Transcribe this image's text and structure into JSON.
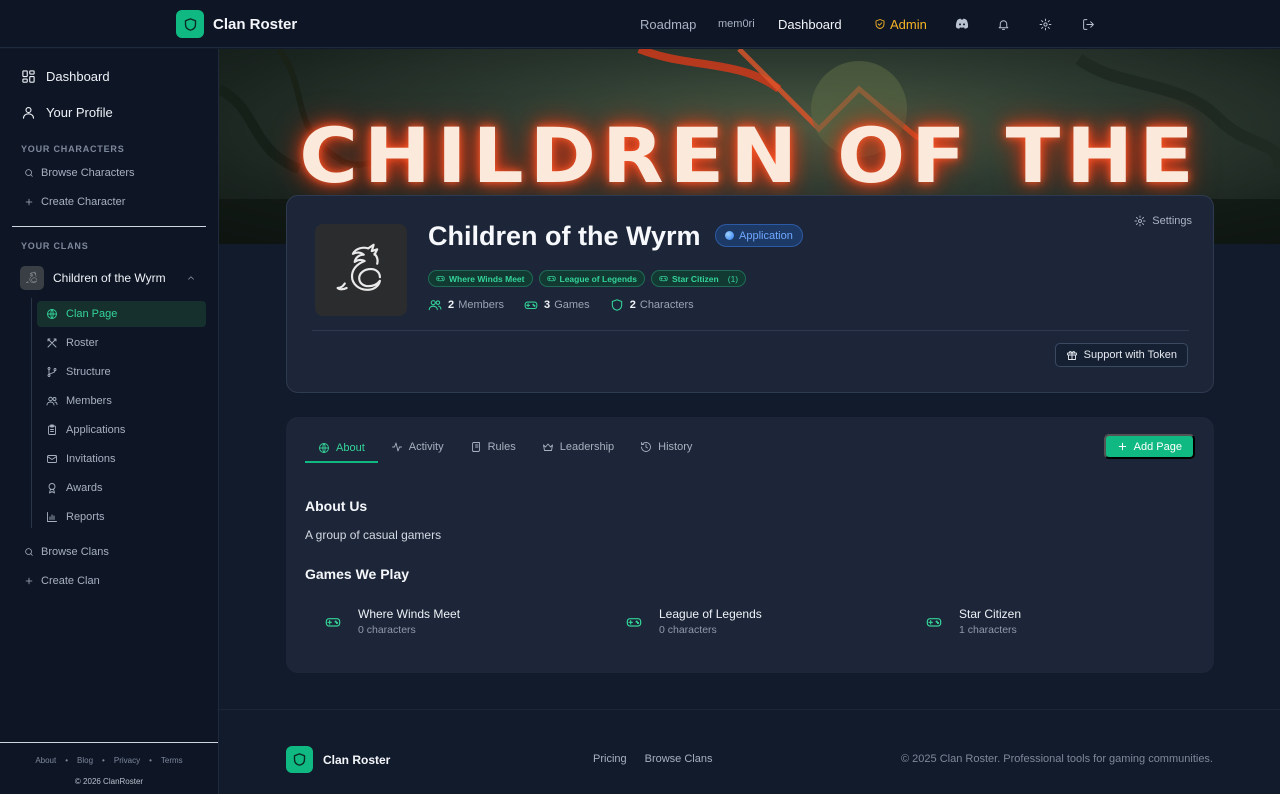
{
  "app": {
    "name": "Clan Roster"
  },
  "nav": {
    "roadmap": "Roadmap",
    "username": "mem0ri",
    "dashboard": "Dashboard",
    "admin": "Admin",
    "icons": [
      "discord-icon",
      "bell-icon",
      "gear-icon",
      "logout-icon"
    ]
  },
  "sidebar": {
    "dashboard": "Dashboard",
    "profile": "Your Profile",
    "characters_section": "YOUR CHARACTERS",
    "browse_characters": "Browse Characters",
    "create_character": "Create Character",
    "clans_section": "YOUR CLANS",
    "clan_name": "Children of the Wyrm",
    "clan_menu": [
      {
        "label": "Clan Page",
        "icon": "globe-icon",
        "active": true
      },
      {
        "label": "Roster",
        "icon": "swords-icon",
        "active": false
      },
      {
        "label": "Structure",
        "icon": "branch-icon",
        "active": false
      },
      {
        "label": "Members",
        "icon": "users-icon",
        "active": false
      },
      {
        "label": "Applications",
        "icon": "clipboard-icon",
        "active": false
      },
      {
        "label": "Invitations",
        "icon": "mail-icon",
        "active": false
      },
      {
        "label": "Awards",
        "icon": "award-icon",
        "active": false
      },
      {
        "label": "Reports",
        "icon": "chart-icon",
        "active": false
      }
    ],
    "browse_clans": "Browse Clans",
    "create_clan": "Create Clan",
    "footer_links": [
      "About",
      "Blog",
      "Privacy",
      "Terms"
    ],
    "copyright": "© 2026 ClanRoster"
  },
  "banner": {
    "text": "CHILDREN OF THE WYRM"
  },
  "clan": {
    "title": "Children of the Wyrm",
    "status": "Application",
    "settings": "Settings",
    "games": [
      {
        "name": "Where Winds Meet",
        "count": ""
      },
      {
        "name": "League of Legends",
        "count": ""
      },
      {
        "name": "Star Citizen",
        "count": "(1)"
      }
    ],
    "stats": [
      {
        "value": "2",
        "label": "Members",
        "icon": "users-icon"
      },
      {
        "value": "3",
        "label": "Games",
        "icon": "gamepad-icon"
      },
      {
        "value": "2",
        "label": "Characters",
        "icon": "shield-icon"
      }
    ],
    "support_button": "Support with Token"
  },
  "tabs": [
    {
      "label": "About",
      "icon": "globe-icon",
      "active": true
    },
    {
      "label": "Activity",
      "icon": "activity-icon",
      "active": false
    },
    {
      "label": "Rules",
      "icon": "scroll-icon",
      "active": false
    },
    {
      "label": "Leadership",
      "icon": "crown-icon",
      "active": false
    },
    {
      "label": "History",
      "icon": "history-icon",
      "active": false
    }
  ],
  "add_page": "Add Page",
  "about": {
    "heading": "About Us",
    "text": "A group of casual gamers",
    "games_heading": "Games We Play",
    "games": [
      {
        "name": "Where Winds Meet",
        "characters": "0 characters"
      },
      {
        "name": "League of Legends",
        "characters": "0 characters"
      },
      {
        "name": "Star Citizen",
        "characters": "1 characters"
      }
    ]
  },
  "footer": {
    "brand": "Clan Roster",
    "links": [
      "Pricing",
      "Browse Clans"
    ],
    "copyright": "© 2025 Clan Roster. Professional tools for gaming communities."
  },
  "colors": {
    "accent": "#10b981",
    "admin": "#f5b324",
    "status": "#6fa7ff",
    "background": "#121b2c"
  }
}
